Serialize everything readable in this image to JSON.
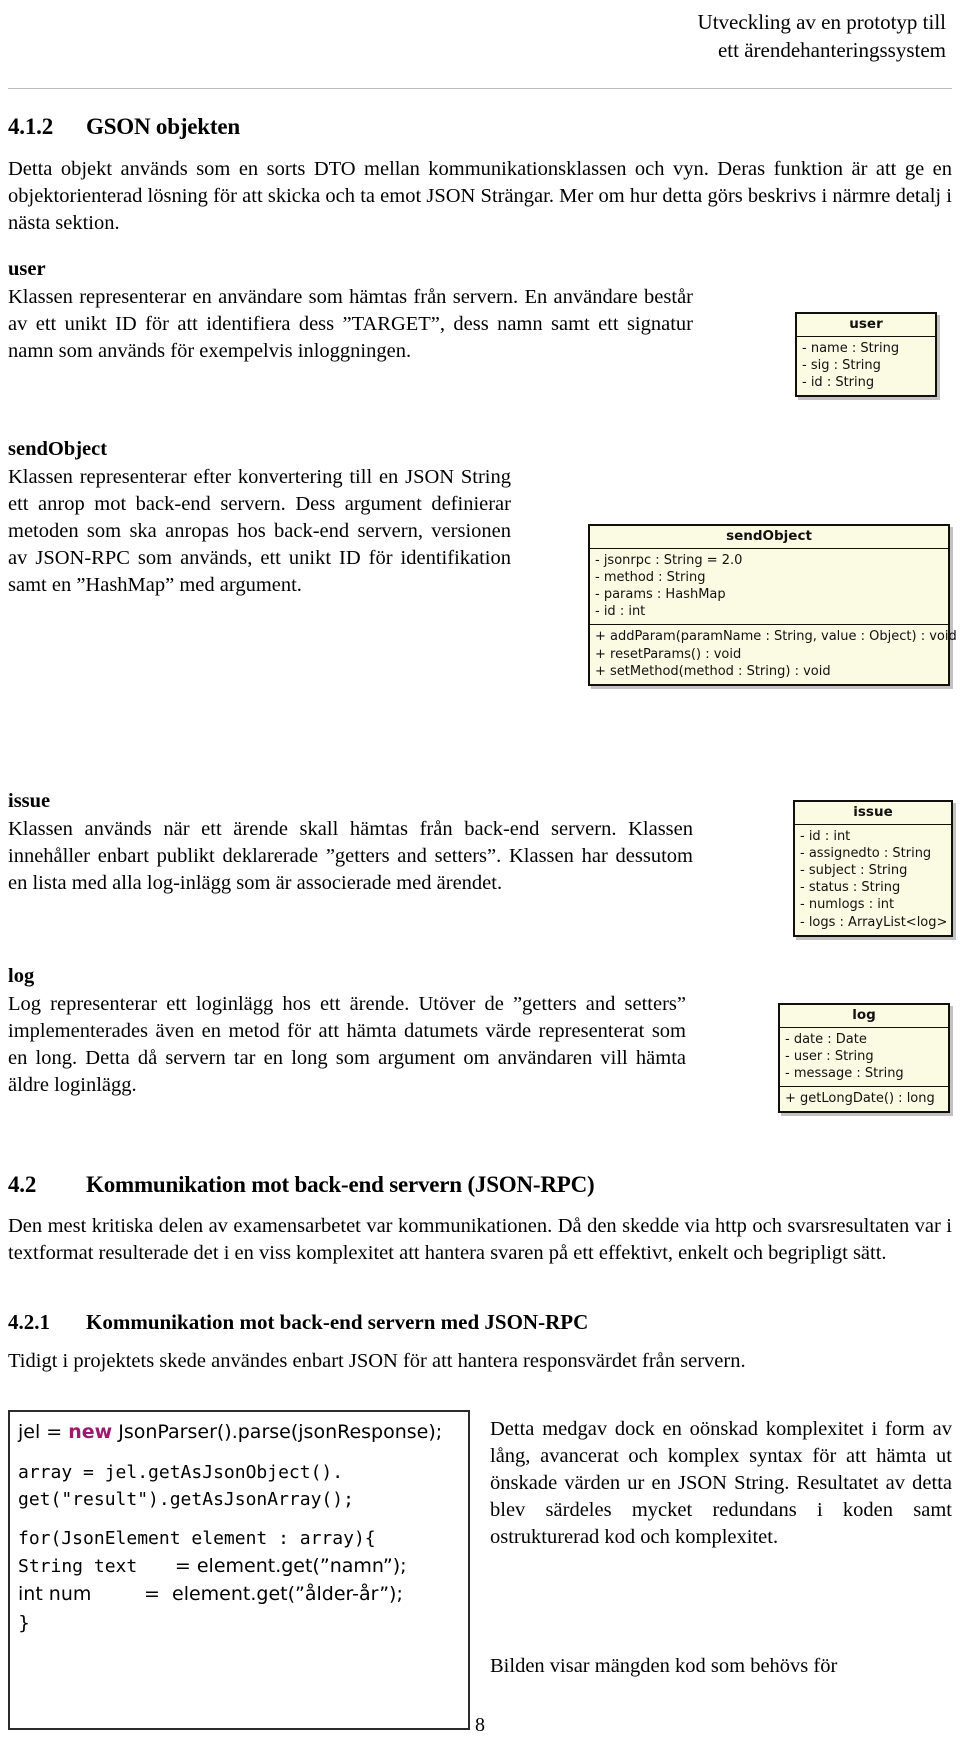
{
  "header": {
    "line1": "Utveckling av en prototyp till",
    "line2": "ett ärendehanteringssystem"
  },
  "sections": {
    "s412": {
      "number": "4.1.2",
      "title": "GSON objekten",
      "intro": "Detta objekt används som en sorts DTO mellan kommunikationsklassen och vyn. Deras funktion är att ge en objektorienterad lösning för att skicka och ta emot JSON Strängar. Mer om hur detta görs beskrivs i närmre detalj i nästa sektion."
    },
    "user": {
      "heading": "user",
      "body": "Klassen representerar en användare som hämtas från servern. En användare består av ett unikt ID för att identifiera dess ”TARGET”, dess namn samt ett signatur namn som används för exempelvis inloggningen."
    },
    "sendobject": {
      "heading": "sendObject",
      "body": "Klassen representerar efter konvertering till en JSON String ett anrop mot back-end servern. Dess argument definierar metoden som ska anropas hos back-end servern, versionen av JSON-RPC som används, ett unikt ID för identifikation samt en ”HashMap” med argument."
    },
    "issue": {
      "heading": "issue",
      "body": "Klassen används när ett ärende skall hämtas från back-end servern. Klassen innehåller enbart publikt deklarerade ”getters and setters”. Klassen har dessutom en lista med alla log-inlägg som är associerade med ärendet."
    },
    "log": {
      "heading": "log",
      "body": "Log representerar ett loginlägg hos ett ärende. Utöver de ”getters and setters” implementerades även en metod för att hämta datumets värde representerat som en long. Detta då servern tar en long som argument om användaren vill hämta äldre loginlägg."
    },
    "s42": {
      "number": "4.2",
      "title": "Kommunikation mot back-end servern (JSON-RPC)",
      "body": "Den mest kritiska delen av examensarbetet var kommunikationen. Då den skedde via http och svarsresultaten var i textformat resulterade det i en viss komplexitet att hantera svaren på ett effektivt, enkelt och begripligt sätt."
    },
    "s421": {
      "number": "4.2.1",
      "title": "Kommunikation mot back-end servern med JSON-RPC",
      "intro": "Tidigt i projektets skede användes enbart JSON för att hantera responsvärdet från servern.",
      "right_col": "Detta medgav dock en oönskad komplexitet i form av lång, avancerat och komplex syntax för att hämta ut önskade värden ur en JSON String. Resultatet av detta blev särdeles mycket redundans i koden samt ostrukturerad kod och komplexitet.",
      "right_col2": "Bilden visar mängden kod som behövs för"
    }
  },
  "uml": {
    "user": {
      "title": "user",
      "attributes": [
        "- name : String",
        "- sig : String",
        "- id : String"
      ]
    },
    "sendobject": {
      "title": "sendObject",
      "attributes": [
        "- jsonrpc : String = 2.0",
        "- method : String",
        "- params : HashMap",
        "- id : int"
      ],
      "methods": [
        "+ addParam(paramName : String, value : Object) : void",
        "+ resetParams() : void",
        "+ setMethod(method : String) : void"
      ]
    },
    "issue": {
      "title": "issue",
      "attributes": [
        "- id : int",
        "- assignedto : String",
        "- subject : String",
        "- status : String",
        "- numlogs : int",
        "- logs : ArrayList<log>"
      ]
    },
    "log": {
      "title": "log",
      "attributes": [
        "- date : Date",
        "- user : String",
        "- message : String"
      ],
      "methods": [
        "+ getLongDate() : long"
      ]
    }
  },
  "code": {
    "line1_a": "jel = ",
    "line1_kw": "new",
    "line1_b": " JsonParser().parse(jsonResponse);",
    "line2": "array = jel.getAsJsonObject().",
    "line3": "get(\"result\").getAsJsonArray();",
    "line4": "for(JsonElement element : array){",
    "line5_mono": "String text  ",
    "line5_sans": "= element.get(”namn”);",
    "line6_sans_a": "int num",
    "line6_sans_b": "=  element.get(”ålder-år”);",
    "line7": "}"
  },
  "footer": {
    "page_number": "8"
  },
  "colors": {
    "uml_fill": "#fbfbe3",
    "uml_border": "#13100b",
    "keyword": "#9c1a6e",
    "rule": "#bdbdbd"
  }
}
